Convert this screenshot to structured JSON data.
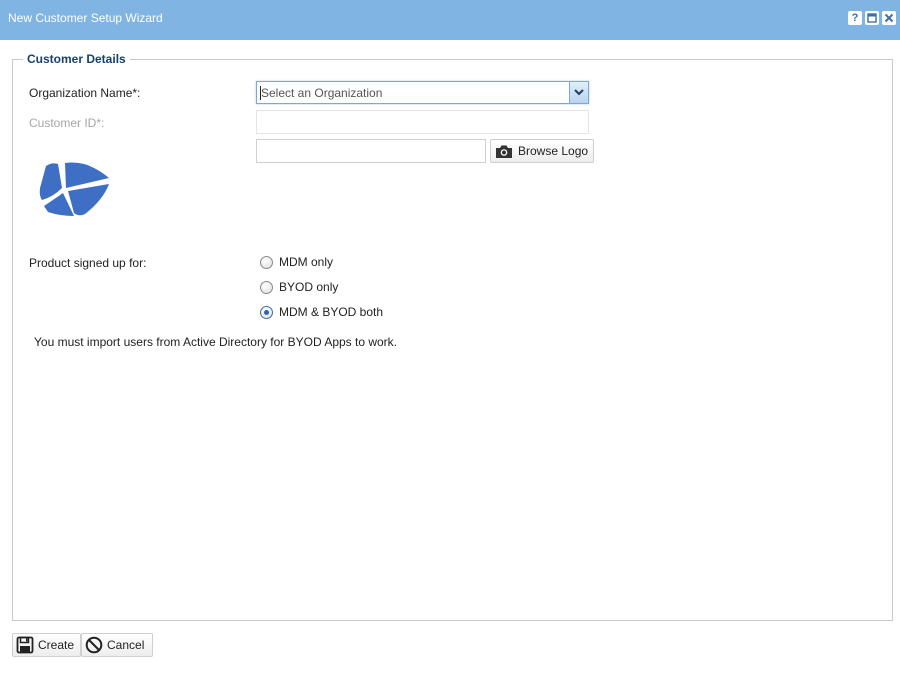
{
  "window": {
    "title": "New Customer Setup Wizard",
    "controls": {
      "help": "?",
      "maximize_icon": "maximize-icon",
      "close_icon": "close-icon"
    }
  },
  "section": {
    "legend": "Customer Details"
  },
  "form": {
    "organization_label": "Organization Name*:",
    "organization_placeholder": "Select an Organization",
    "customer_id_label": "Customer ID*:",
    "customer_id_value": "",
    "logo_path_value": "",
    "browse_logo_label": "Browse Logo",
    "browse_icon": "camera-icon",
    "product_label": "Product signed up for:",
    "product_options": [
      {
        "label": "MDM only",
        "checked": false
      },
      {
        "label": "BYOD only",
        "checked": false
      },
      {
        "label": "MDM & BYOD both",
        "checked": true
      }
    ],
    "notice": "You must import users from Active Directory for BYOD Apps to work."
  },
  "footer": {
    "create_label": "Create",
    "create_icon": "save-icon",
    "cancel_label": "Cancel",
    "cancel_icon": "cancel-icon"
  },
  "colors": {
    "titlebar": "#80b4e2",
    "legend_text": "#15416f",
    "logo_blue": "#3e6fc4",
    "radio_selected": "#2a66b0"
  }
}
